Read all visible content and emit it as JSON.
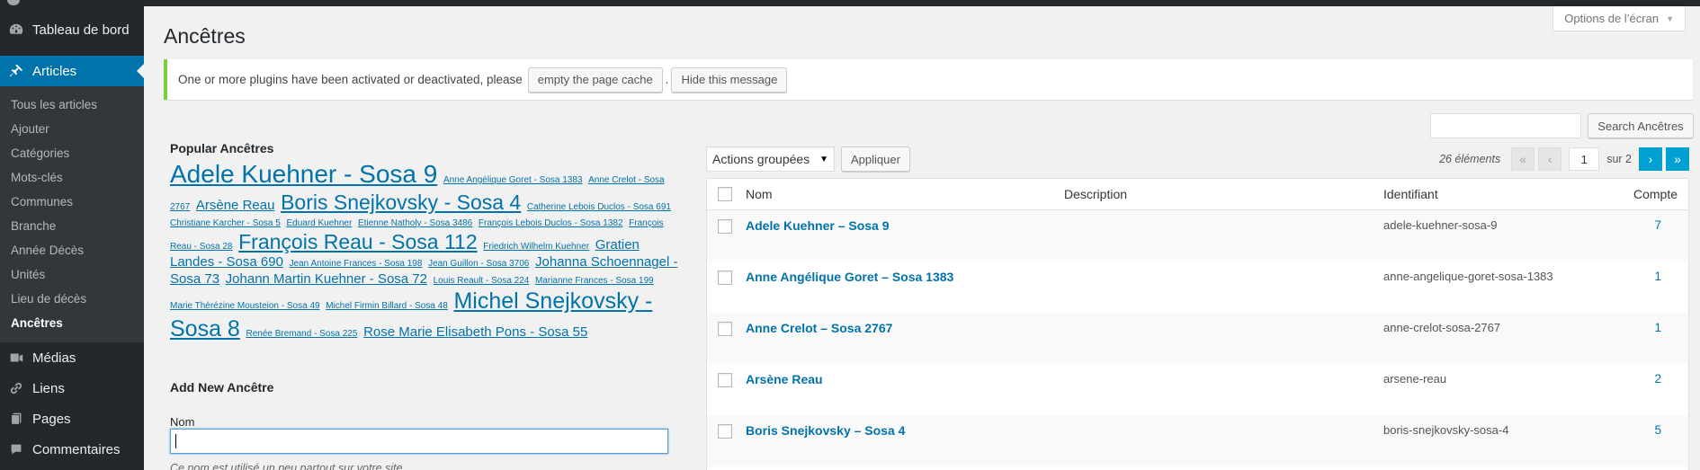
{
  "sidebar": {
    "dashboard": "Tableau de bord",
    "articles": "Articles",
    "submenu": [
      "Tous les articles",
      "Ajouter",
      "Catégories",
      "Mots-clés",
      "Communes",
      "Branche",
      "Année Décès",
      "Unités",
      "Lieu de décès",
      "Ancêtres"
    ],
    "medias": "Médias",
    "liens": "Liens",
    "pages": "Pages",
    "commentaires": "Commentaires"
  },
  "header": {
    "screen_options": "Options de l’écran",
    "title": "Ancêtres"
  },
  "notice": {
    "text": "One or more plugins have been activated or deactivated, please",
    "empty_cache": "empty the page cache",
    "period": ".",
    "hide": "Hide this message"
  },
  "search": {
    "button": "Search Ancêtres",
    "value": ""
  },
  "popular": {
    "title": "Popular Ancêtres",
    "tags": [
      {
        "label": "Adele Kuehner - Sosa 9",
        "size": "28px"
      },
      {
        "label": "Anne Angélique Goret - Sosa 1383",
        "size": "10px"
      },
      {
        "label": "Anne Crelot - Sosa 2767",
        "size": "10px"
      },
      {
        "label": "Arsène Reau",
        "size": "15px"
      },
      {
        "label": "Boris Snejkovsky - Sosa 4",
        "size": "23px"
      },
      {
        "label": "Catherine Lebois Duclos - Sosa 691",
        "size": "10px"
      },
      {
        "label": "Christiane Karcher - Sosa 5",
        "size": "10px"
      },
      {
        "label": "Eduard Kuehner",
        "size": "10px"
      },
      {
        "label": "Etienne Natholy - Sosa 3486",
        "size": "10px"
      },
      {
        "label": "François Lebois Duclos - Sosa 1382",
        "size": "10px"
      },
      {
        "label": "François Reau - Sosa 28",
        "size": "10px"
      },
      {
        "label": "François Reau - Sosa 112",
        "size": "23px"
      },
      {
        "label": "Friedrich Wilhelm Kuehner",
        "size": "10px"
      },
      {
        "label": "Gratien Landes - Sosa 690",
        "size": "15px"
      },
      {
        "label": "Jean Antoine Frances - Sosa 198",
        "size": "10px"
      },
      {
        "label": "Jean Guillon - Sosa 3706",
        "size": "10px"
      },
      {
        "label": "Johanna Schoennagel - Sosa 73",
        "size": "15px"
      },
      {
        "label": "Johann Martin Kuehner - Sosa 72",
        "size": "15px"
      },
      {
        "label": "Louis Reault - Sosa 224",
        "size": "10px"
      },
      {
        "label": "Marianne Frances - Sosa 199",
        "size": "10px"
      },
      {
        "label": "Marie Thérézine Mousteion - Sosa 49",
        "size": "10px"
      },
      {
        "label": "Michel Firmin Billard - Sosa 48",
        "size": "10px"
      },
      {
        "label": "Michel Snejkovsky - Sosa 8",
        "size": "25px"
      },
      {
        "label": "Renée Bremand - Sosa 225",
        "size": "10px"
      },
      {
        "label": "Rose Marie Elisabeth Pons - Sosa 55",
        "size": "15px"
      }
    ]
  },
  "add_new": {
    "title": "Add New Ancêtre",
    "nom_label": "Nom",
    "nom_value": "",
    "help": "Ce nom est utilisé un peu partout sur votre site."
  },
  "toolbar": {
    "bulk_actions": "Actions groupées",
    "apply": "Appliquer",
    "items_count": "26 éléments",
    "first": "«",
    "prev": "‹",
    "current_page": "1",
    "of_label": "sur 2",
    "next": "›",
    "last": "»"
  },
  "table": {
    "headers": {
      "nom": "Nom",
      "description": "Description",
      "identifiant": "Identifiant",
      "compte": "Compte"
    },
    "rows": [
      {
        "nom": "Adele Kuehner – Sosa 9",
        "desc": "",
        "id": "adele-kuehner-sosa-9",
        "count": "7"
      },
      {
        "nom": "Anne Angélique Goret – Sosa 1383",
        "desc": "",
        "id": "anne-angelique-goret-sosa-1383",
        "count": "1"
      },
      {
        "nom": "Anne Crelot – Sosa 2767",
        "desc": "",
        "id": "anne-crelot-sosa-2767",
        "count": "1"
      },
      {
        "nom": "Arsène Reau",
        "desc": "",
        "id": "arsene-reau",
        "count": "2"
      },
      {
        "nom": "Boris Snejkovsky – Sosa 4",
        "desc": "",
        "id": "boris-snejkovsky-sosa-4",
        "count": "5"
      }
    ]
  },
  "colors": {
    "sidebar": "#23282d",
    "accent": "#0073aa",
    "notice_border": "#7ad03a",
    "page_active": "#00a0d2"
  }
}
